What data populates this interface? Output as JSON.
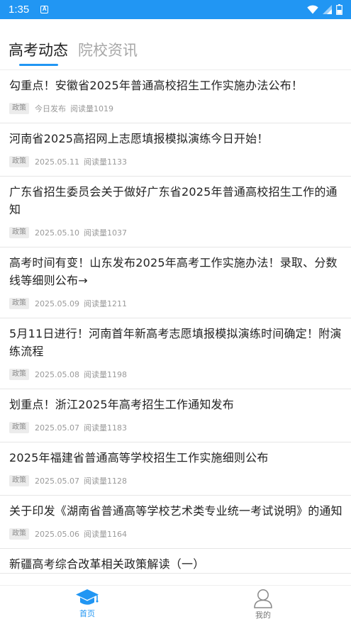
{
  "status_bar": {
    "time": "1:35",
    "notification_icon": "A"
  },
  "tabs": [
    {
      "label": "高考动态",
      "active": true
    },
    {
      "label": "院校资讯",
      "active": false
    }
  ],
  "news": [
    {
      "title": "勾重点！安徽省2025年普通高校招生工作实施办法公布！",
      "tag": "政策",
      "date": "今日发布",
      "reads": "阅读量1019"
    },
    {
      "title": "河南省2025高招网上志愿填报模拟演练今日开始！",
      "tag": "政策",
      "date": "2025.05.11",
      "reads": "阅读量1133"
    },
    {
      "title": "广东省招生委员会关于做好广东省2025年普通高校招生工作的通知",
      "tag": "政策",
      "date": "2025.05.10",
      "reads": "阅读量1037"
    },
    {
      "title": "高考时间有变！山东发布2025年高考工作实施办法！录取、分数线等细则公布→",
      "tag": "政策",
      "date": "2025.05.09",
      "reads": "阅读量1211"
    },
    {
      "title": "5月11日进行！河南首年新高考志愿填报模拟演练时间确定！附演练流程",
      "tag": "政策",
      "date": "2025.05.08",
      "reads": "阅读量1198"
    },
    {
      "title": "划重点！浙江2025年高考招生工作通知发布",
      "tag": "政策",
      "date": "2025.05.07",
      "reads": "阅读量1183"
    },
    {
      "title": "2025年福建省普通高等学校招生工作实施细则公布",
      "tag": "政策",
      "date": "2025.05.07",
      "reads": "阅读量1128"
    },
    {
      "title": "关于印发《湖南省普通高等学校艺术类专业统一考试说明》的通知",
      "tag": "政策",
      "date": "2025.05.06",
      "reads": "阅读量1164"
    },
    {
      "title": "新疆高考综合改革相关政策解读（一）",
      "tag": "",
      "date": "",
      "reads": ""
    }
  ],
  "bottom_nav": {
    "home_label": "首页",
    "home_icon": "graduation-cap-icon",
    "me_label": "我的",
    "me_icon": "user-icon",
    "active": "home"
  },
  "colors": {
    "accent": "#2196F3",
    "inactive_tab": "#a7a7a7",
    "tag_bg": "#ececec"
  }
}
